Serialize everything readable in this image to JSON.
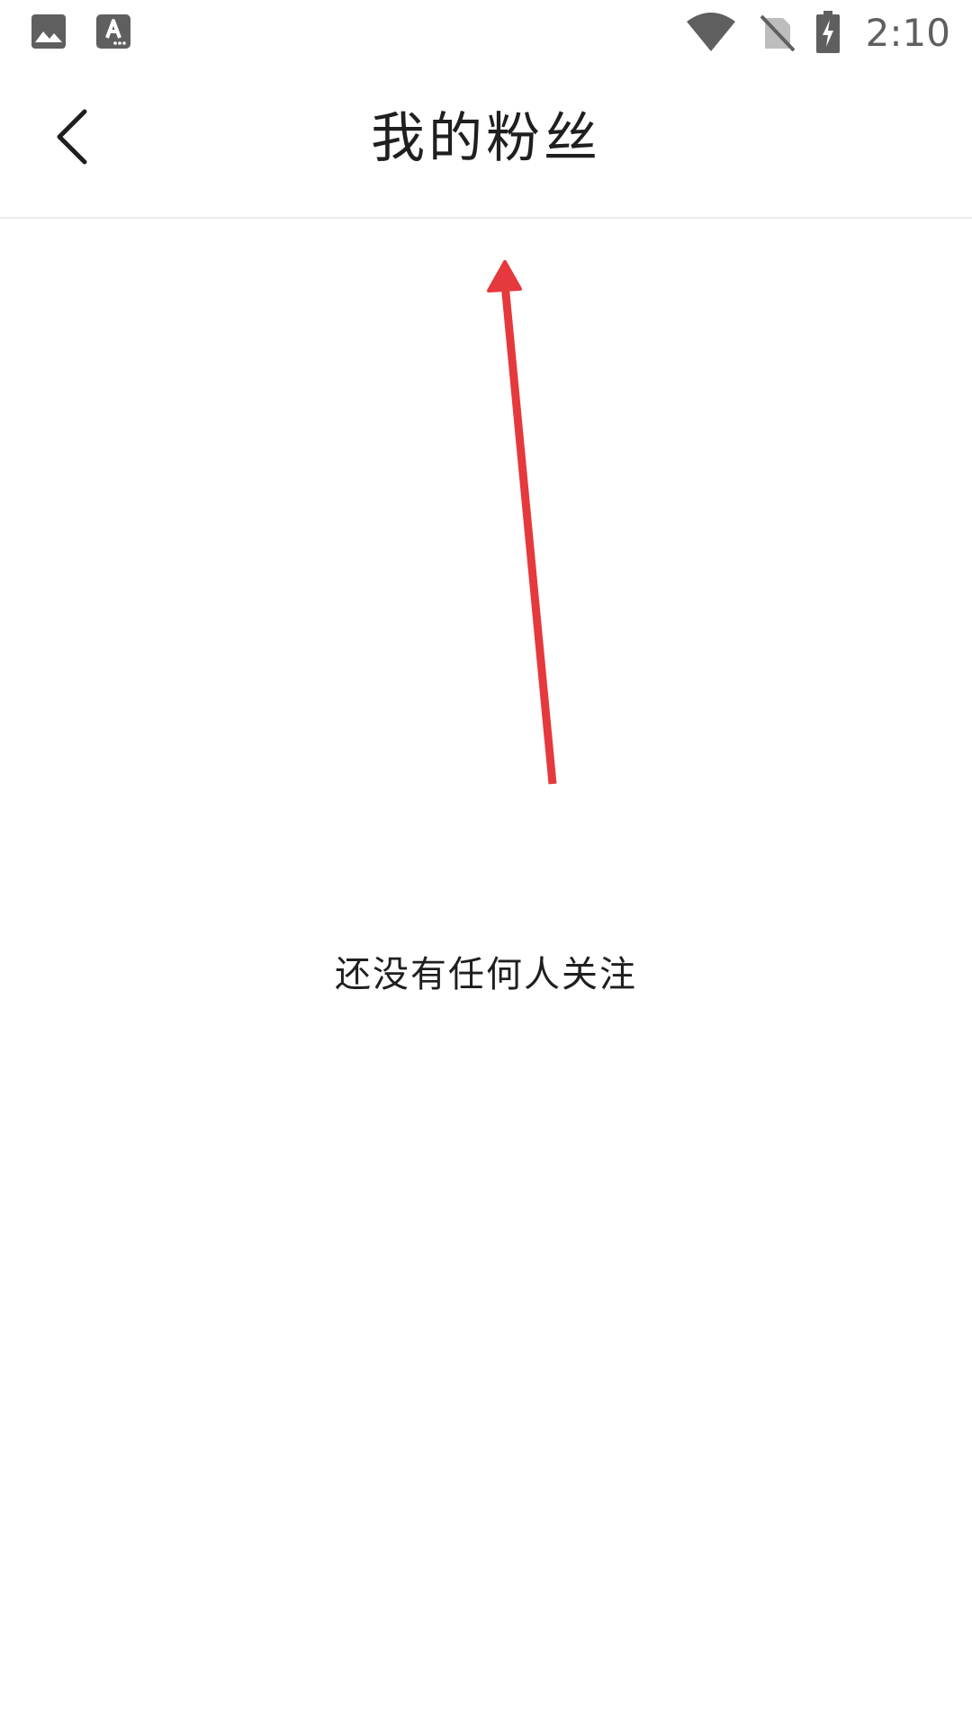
{
  "status_bar": {
    "time": "2:10",
    "icons": [
      "image-icon",
      "font-download-icon",
      "wifi-icon",
      "no-sim-icon",
      "battery-charging-icon"
    ]
  },
  "app_bar": {
    "title": "我的粉丝",
    "back_icon": "chevron-left-icon"
  },
  "content": {
    "empty_message": "还没有任何人关注"
  },
  "colors": {
    "background": "#ffffff",
    "text": "#1f1f1f",
    "status_icon": "#5f5f5f",
    "divider": "#ececec",
    "annotation_arrow": "#e5393d"
  }
}
